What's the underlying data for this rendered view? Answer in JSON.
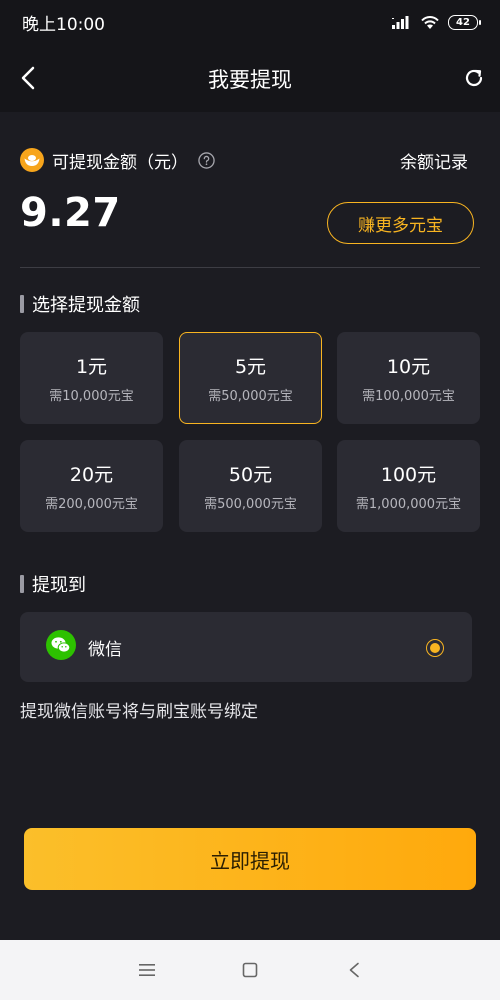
{
  "status_bar": {
    "time": "晚上10:00",
    "battery": "42"
  },
  "header": {
    "title": "我要提现",
    "back_icon": "chevron-left-icon",
    "refresh_icon": "refresh-icon"
  },
  "balance": {
    "label": "可提现金额（元）",
    "amount": "9.27",
    "records_label": "余额记录",
    "earn_button": "赚更多元宝"
  },
  "choose_amount": {
    "title": "选择提现金额",
    "options": [
      {
        "value": "1元",
        "need": "需10,000元宝",
        "selected": false
      },
      {
        "value": "5元",
        "need": "需50,000元宝",
        "selected": true
      },
      {
        "value": "10元",
        "need": "需100,000元宝",
        "selected": false
      },
      {
        "value": "20元",
        "need": "需200,000元宝",
        "selected": false
      },
      {
        "value": "50元",
        "need": "需500,000元宝",
        "selected": false
      },
      {
        "value": "100元",
        "need": "需1,000,000元宝",
        "selected": false
      }
    ]
  },
  "withdraw_to": {
    "title": "提现到",
    "method": "微信",
    "selected": true,
    "note": "提现微信账号将与刷宝账号绑定"
  },
  "submit_button": "立即提现",
  "colors": {
    "accent": "#f8b421",
    "background": "#1c1c22",
    "card": "#2b2b33",
    "wechat": "#2dc100"
  }
}
